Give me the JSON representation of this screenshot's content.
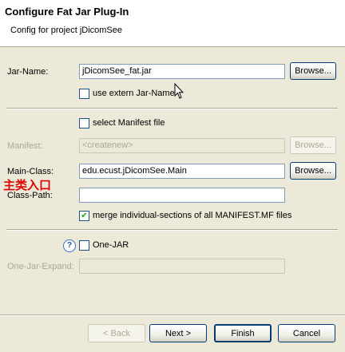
{
  "header": {
    "title": "Configure Fat Jar Plug-In",
    "subtitle": "Config for project jDicomSee"
  },
  "jar": {
    "label": "Jar-Name:",
    "value": "jDicomSee_fat.jar",
    "browse": "Browse...",
    "extern_label": "use extern Jar-Name",
    "extern_checked": false
  },
  "manifest": {
    "select_label": "select Manifest file",
    "select_checked": false,
    "label": "Manifest:",
    "value": "<createnew>",
    "browse": "Browse..."
  },
  "main_class": {
    "label": "Main-Class:",
    "value": "edu.ecust.jDicomSee.Main",
    "browse": "Browse...",
    "annotation": "主类入口"
  },
  "class_path": {
    "label": "Class-Path:",
    "value": ""
  },
  "merge": {
    "label": "merge individual-sections of all MANIFEST.MF files",
    "checked": true
  },
  "one_jar": {
    "help": "?",
    "label": "One-JAR",
    "checked": false,
    "expand_label": "One-Jar-Expand:",
    "expand_value": ""
  },
  "buttons": {
    "back": "< Back",
    "next": "Next >",
    "finish": "Finish",
    "cancel": "Cancel"
  },
  "colors": {
    "dialog_bg": "#ece9d8",
    "header_bg": "#ffffff",
    "annotation": "#e00000",
    "check": "#21a121"
  }
}
